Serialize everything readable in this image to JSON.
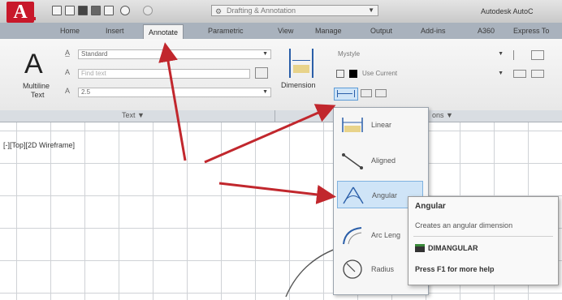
{
  "app": {
    "logo_letter": "A",
    "title": "Autodesk AutoC"
  },
  "quick_access": {
    "workspace": "Drafting & Annotation"
  },
  "tabs": [
    {
      "label": "Home"
    },
    {
      "label": "Insert"
    },
    {
      "label": "Annotate"
    },
    {
      "label": "Parametric"
    },
    {
      "label": "View"
    },
    {
      "label": "Manage"
    },
    {
      "label": "Output"
    },
    {
      "label": "Add-ins"
    },
    {
      "label": "A360"
    },
    {
      "label": "Express To"
    }
  ],
  "active_tab": "Annotate",
  "text_panel": {
    "multiline_label_1": "Multiline",
    "multiline_label_2": "Text",
    "text_style": "Standard",
    "find_placeholder": "Find text",
    "text_height": "2.5",
    "title": "Text"
  },
  "dimension_panel": {
    "button_label": "Dimension",
    "dim_style": "Mystyle",
    "layer": "Use Current",
    "title": "ons"
  },
  "viewport": {
    "label": "[-][Top][2D Wireframe]"
  },
  "dim_menu": {
    "items": [
      {
        "label": "Linear",
        "icon": "linear-dim-icon"
      },
      {
        "label": "Aligned",
        "icon": "aligned-dim-icon"
      },
      {
        "label": "Angular",
        "icon": "angular-dim-icon",
        "highlighted": true
      },
      {
        "label": "Arc Leng",
        "icon": "arc-length-dim-icon"
      },
      {
        "label": "Radius",
        "icon": "radius-dim-icon"
      }
    ]
  },
  "tooltip": {
    "title": "Angular",
    "description": "Creates an angular dimension",
    "command": "DIMANGULAR",
    "help": "Press F1 for more help"
  },
  "colors": {
    "ribbon_tab_bar": "#a9b2bd",
    "highlight": "#cfe4f7",
    "arrow": "#c1272d",
    "logo": "#c8182a"
  }
}
